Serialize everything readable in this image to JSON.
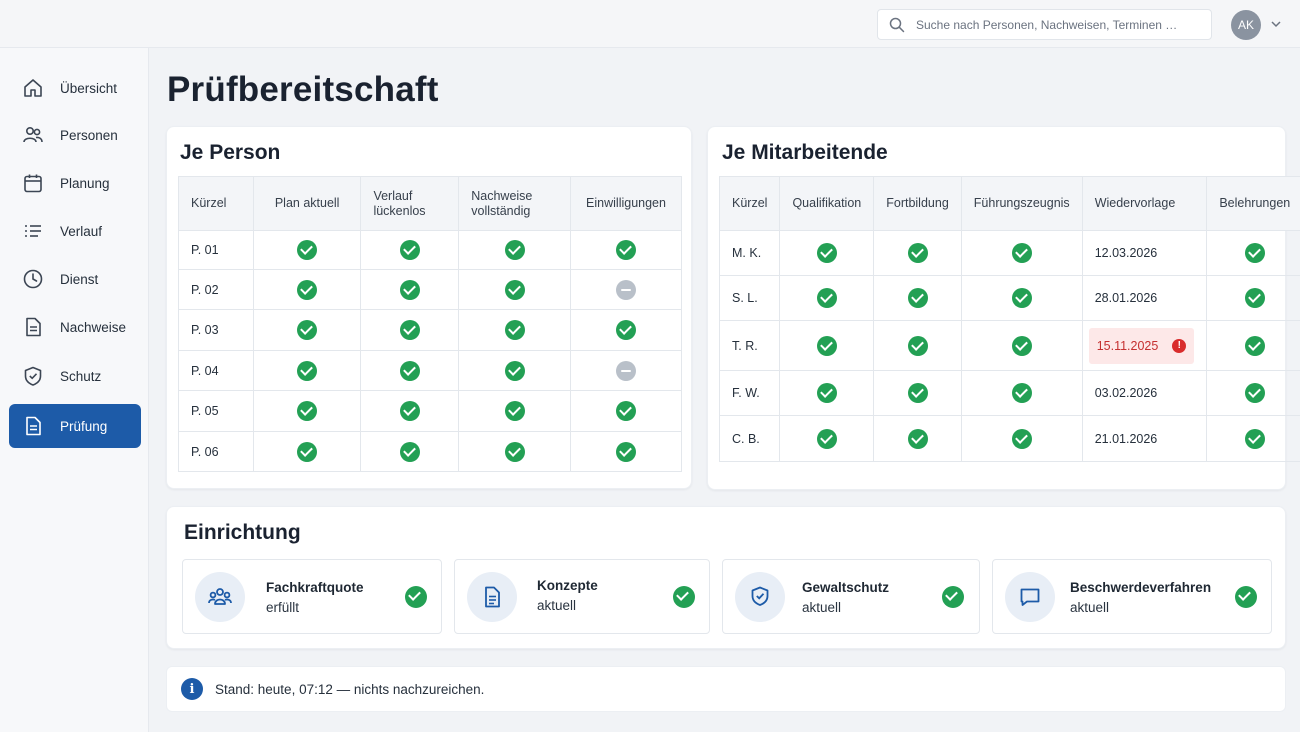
{
  "header": {
    "search_placeholder": "Suche nach Personen, Nachweisen, Terminen …",
    "avatar_initials": "AK"
  },
  "sidebar": {
    "items": [
      {
        "label": "Übersicht",
        "icon": "home-icon",
        "active": false
      },
      {
        "label": "Personen",
        "icon": "people-icon",
        "active": false
      },
      {
        "label": "Planung",
        "icon": "calendar-icon",
        "active": false
      },
      {
        "label": "Verlauf",
        "icon": "list-icon",
        "active": false
      },
      {
        "label": "Dienst",
        "icon": "clock-icon",
        "active": false
      },
      {
        "label": "Nachweise",
        "icon": "document-icon",
        "active": false
      },
      {
        "label": "Schutz",
        "icon": "shield-icon",
        "active": false
      },
      {
        "label": "Prüfung",
        "icon": "checklist-document-icon",
        "active": true
      }
    ]
  },
  "page": {
    "title": "Prüfbereitschaft"
  },
  "person_card": {
    "title": "Je Person",
    "columns": [
      "Kürzel",
      "Plan aktuell",
      "Verlauf lückenlos",
      "Nachweise vollständig",
      "Einwilligungen"
    ],
    "rows": [
      {
        "id": "P. 01",
        "status": [
          "ok",
          "ok",
          "ok",
          "ok"
        ]
      },
      {
        "id": "P. 02",
        "status": [
          "ok",
          "ok",
          "ok",
          "neutral"
        ]
      },
      {
        "id": "P. 03",
        "status": [
          "ok",
          "ok",
          "ok",
          "ok"
        ]
      },
      {
        "id": "P. 04",
        "status": [
          "ok",
          "ok",
          "ok",
          "neutral"
        ]
      },
      {
        "id": "P. 05",
        "status": [
          "ok",
          "ok",
          "ok",
          "ok"
        ]
      },
      {
        "id": "P. 06",
        "status": [
          "ok",
          "ok",
          "ok",
          "ok"
        ]
      }
    ]
  },
  "staff_card": {
    "title": "Je Mitarbeitende",
    "columns": [
      "Kürzel",
      "Qualifikation",
      "Fortbildung",
      "Führungszeugnis",
      "Wiedervorlage",
      "Belehrungen"
    ],
    "rows": [
      {
        "id": "M. K.",
        "date": "12.03.2026",
        "overdue": false
      },
      {
        "id": "S. L.",
        "date": "28.01.2026",
        "overdue": false
      },
      {
        "id": "T. R.",
        "date": "15.11.2025",
        "overdue": true
      },
      {
        "id": "F. W.",
        "date": "03.02.2026",
        "overdue": false
      },
      {
        "id": "C. B.",
        "date": "21.01.2026",
        "overdue": false
      }
    ]
  },
  "facility_card": {
    "title": "Einrichtung",
    "tiles": [
      {
        "line1": "Fachkraftquote",
        "line2": "erfüllt",
        "icon": "team-icon"
      },
      {
        "line1": "Konzepte",
        "line2": "aktuell",
        "icon": "document-icon"
      },
      {
        "line1": "Gewaltschutz",
        "line2": "aktuell",
        "icon": "shield-check-icon"
      },
      {
        "line1": "Beschwerdeverfahren",
        "line2": "aktuell",
        "icon": "chat-bubble-icon"
      }
    ]
  },
  "footer_note": {
    "text": "Stand: heute, 07:12 — nichts nachzureichen."
  },
  "colors": {
    "accent": "#1d5ba8",
    "success": "#23a054",
    "neutral": "#b9c0c9",
    "danger": "#d92c2c"
  }
}
